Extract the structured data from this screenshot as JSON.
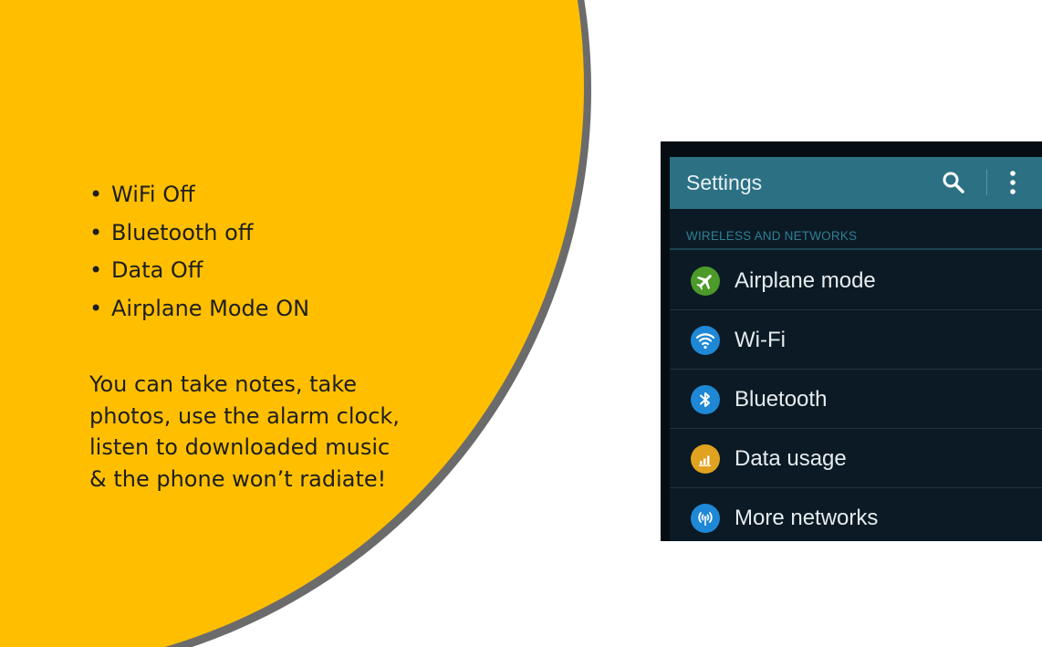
{
  "slide": {
    "bullets": [
      "WiFi Off",
      "Bluetooth off",
      "Data Off",
      "Airplane Mode ON"
    ],
    "bullet_glyph": "•",
    "notes_lines": [
      "You can take notes, take",
      "photos, use the alarm clock,",
      "listen to downloaded music",
      "& the phone won’t radiate!"
    ],
    "colors": {
      "circle_fill": "#ffbf00",
      "circle_border": "#6b6b6b"
    }
  },
  "settings": {
    "title": "Settings",
    "search_icon": "search-icon",
    "menu_icon": "overflow-menu-icon",
    "section_header": "WIRELESS AND NETWORKS",
    "items": [
      {
        "label": "Airplane mode",
        "icon": "airplane-icon",
        "icon_color": "#4c9a2a"
      },
      {
        "label": "Wi-Fi",
        "icon": "wifi-icon",
        "icon_color": "#1e88d6"
      },
      {
        "label": "Bluetooth",
        "icon": "bluetooth-icon",
        "icon_color": "#1e88d6"
      },
      {
        "label": "Data usage",
        "icon": "data-usage-icon",
        "icon_color": "#e0a21f"
      },
      {
        "label": "More networks",
        "icon": "more-networks-icon",
        "icon_color": "#1e88d6"
      }
    ],
    "colors": {
      "appbar": "#2b7083",
      "background": "#0b1a24",
      "section_header": "#2f7f96"
    }
  }
}
